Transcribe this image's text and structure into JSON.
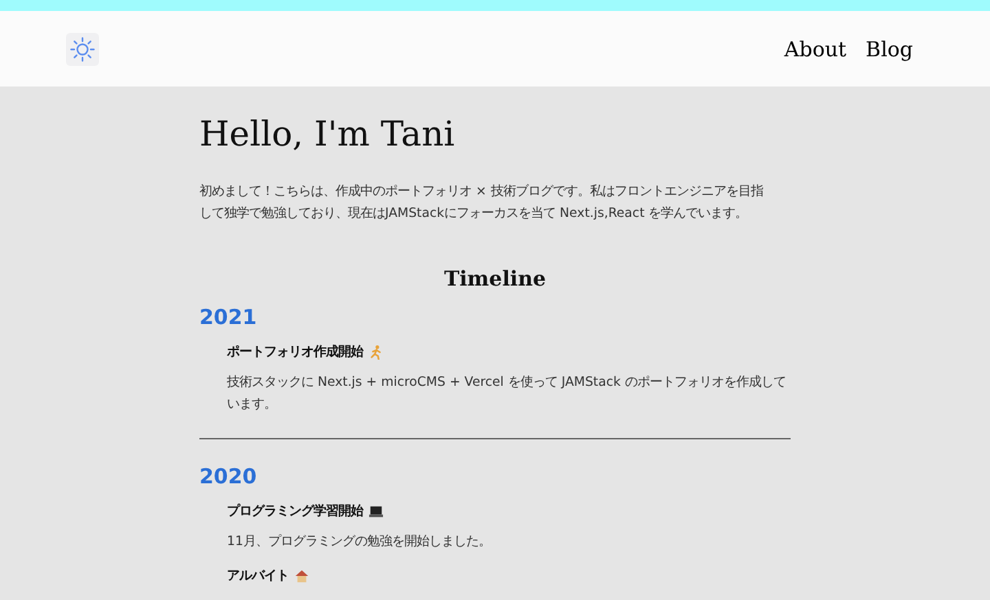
{
  "nav": {
    "links": [
      "About",
      "Blog"
    ]
  },
  "title": "Hello, I'm Tani",
  "intro": "初めまして！こちらは、作成中のポートフォリオ × 技術ブログです。私はフロントエンジニアを目指して独学で勉強しており、現在はJAMStackにフォーカスを当て Next.js,React を学んでいます。",
  "timeline": {
    "heading": "Timeline",
    "years": [
      {
        "year": "2021",
        "items": [
          {
            "title": "ポートフォリオ作成開始",
            "kind": "runner",
            "text": "技術スタックに Next.js + microCMS + Vercel を使って JAMStack のポートフォリオを作成しています。"
          }
        ]
      },
      {
        "year": "2020",
        "items": [
          {
            "title": "プログラミング学習開始",
            "kind": "laptop",
            "text": "11月、プログラミングの勉強を開始しました。"
          },
          {
            "title": "アルバイト",
            "kind": "house"
          }
        ]
      }
    ]
  }
}
